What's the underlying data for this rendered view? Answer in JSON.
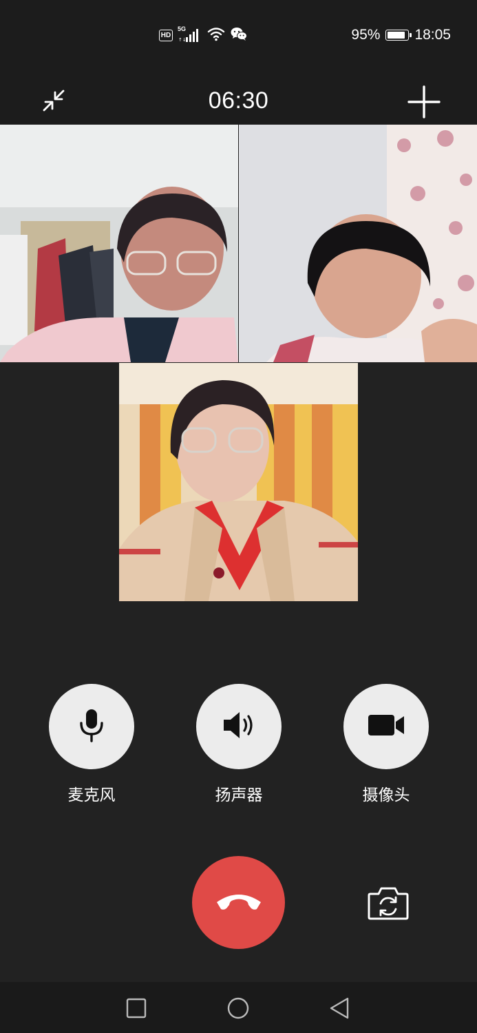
{
  "status_bar": {
    "network_badge": "HD",
    "network_type": "5G",
    "signal_icon": "signal-icon",
    "wifi_icon": "wifi-icon",
    "app_icon": "wechat-icon",
    "battery_percent": "95%",
    "battery_level": 0.95,
    "time": "18:05"
  },
  "call": {
    "timer": "06:30",
    "minimize_icon": "minimize-icon",
    "add_icon": "plus-icon"
  },
  "participants": [
    {
      "tile": "participant-video-1"
    },
    {
      "tile": "participant-video-2"
    },
    {
      "tile": "participant-video-self"
    }
  ],
  "controls": {
    "mic_label": "麦克风",
    "speaker_label": "扬声器",
    "camera_label": "摄像头"
  },
  "actions": {
    "hangup_icon": "hangup-icon",
    "switch_camera_icon": "switch-camera-icon"
  },
  "colors": {
    "background": "#222222",
    "hangup": "#e04a47",
    "control_circle": "#ececec"
  }
}
